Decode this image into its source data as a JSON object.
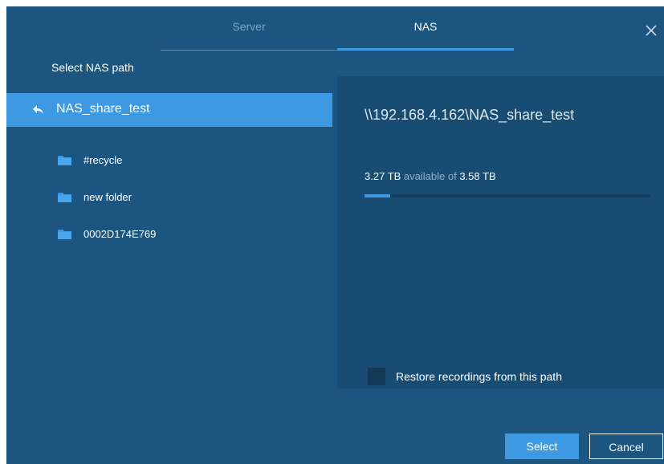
{
  "tabs": [
    {
      "label": "Server",
      "active": false
    },
    {
      "label": "NAS",
      "active": true
    }
  ],
  "dialog": {
    "section_title": "Select NAS path"
  },
  "current_path": {
    "label": "NAS_share_test",
    "icon": "back-arrow-icon"
  },
  "folders": [
    {
      "name": "#recycle",
      "icon": "folder-icon"
    },
    {
      "name": "new folder",
      "icon": "folder-icon"
    },
    {
      "name": "0002D174E769",
      "icon": "folder-icon"
    }
  ],
  "details": {
    "path": "\\\\192.168.4.162\\NAS_share_test",
    "available": "3.27 TB",
    "available_text": "available of",
    "total": "3.58 TB",
    "used_fraction": 0.09
  },
  "restore": {
    "label": "Restore recordings from this path",
    "checked": false
  },
  "buttons": {
    "select": "Select",
    "cancel": "Cancel"
  },
  "colors": {
    "background": "#1c5680",
    "panel": "#184c72",
    "accent": "#3d9ae2"
  }
}
